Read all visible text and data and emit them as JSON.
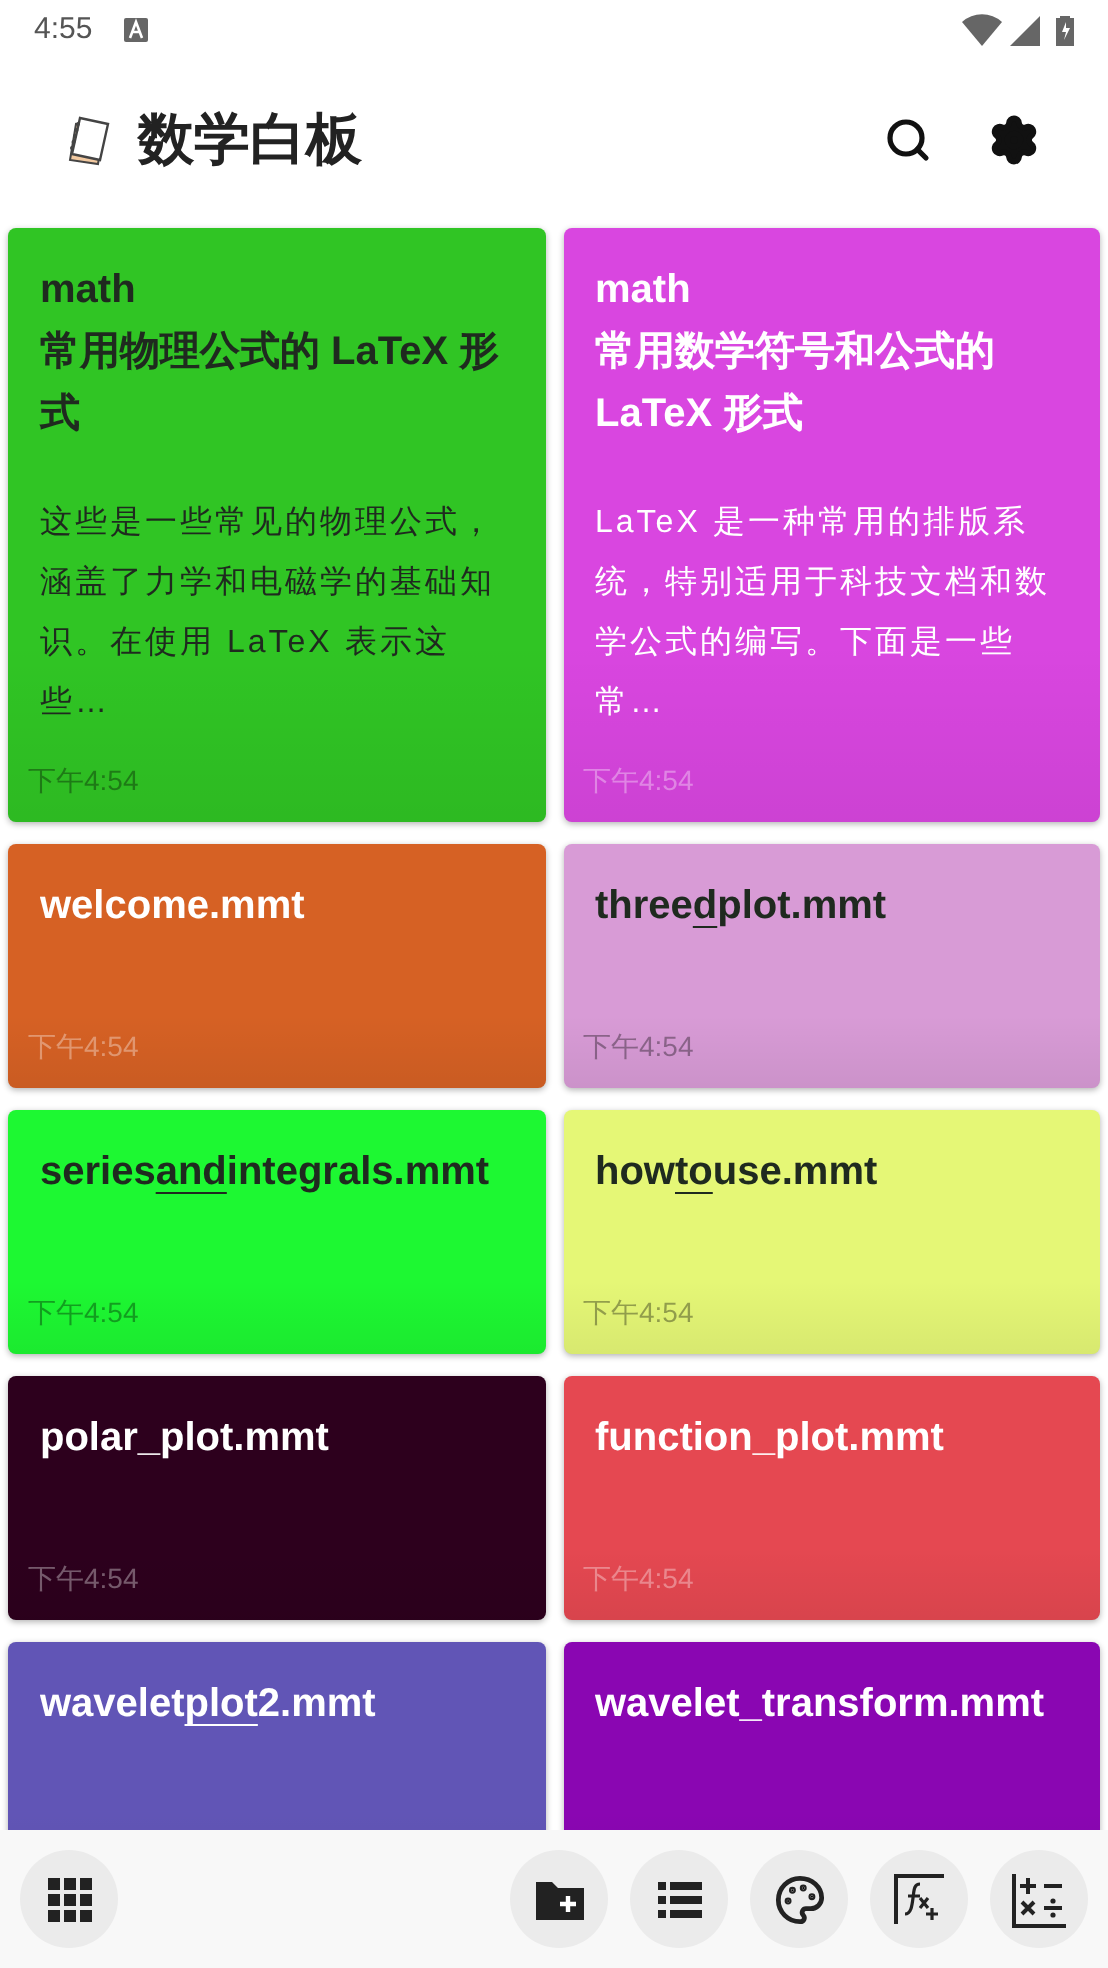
{
  "status_bar": {
    "time": "4:55"
  },
  "app_bar": {
    "title": "数学白板"
  },
  "columns": [
    {
      "cards": [
        {
          "color": "#30c524",
          "kind": "dark",
          "title": [
            {
              "text": "math\n常用物理公式的 LaTeX 形式",
              "underlined": false
            }
          ],
          "description": "这些是一些常见的物理公式，涵盖了力学和电磁学的基础知识。在使用 LaTeX 表示这些…",
          "time": "下午4:54"
        },
        {
          "color": "#d66124",
          "kind": "light",
          "title": [
            {
              "text": "welcome.mmt",
              "underlined": false
            }
          ],
          "time": "下午4:54"
        },
        {
          "color": "#1df832",
          "kind": "dark",
          "title": [
            {
              "text": "series",
              "underlined": false
            },
            {
              "text": "and",
              "underlined": true
            },
            {
              "text": "integrals.mmt",
              "underlined": false
            }
          ],
          "time": "下午4:54"
        },
        {
          "color": "#2d001d",
          "kind": "light",
          "title": [
            {
              "text": "polar_plot.mmt",
              "underlined": false
            }
          ],
          "time": "下午4:54"
        },
        {
          "color": "#6155b6",
          "kind": "light",
          "title": [
            {
              "text": "wavelet",
              "underlined": false
            },
            {
              "text": "plot",
              "underlined": true
            },
            {
              "text": "2.mmt",
              "underlined": false
            }
          ]
        }
      ]
    },
    {
      "cards": [
        {
          "color": "#d946e0",
          "kind": "light",
          "title": [
            {
              "text": "math\n常用数学符号和公式的 LaTeX 形式",
              "underlined": false
            }
          ],
          "description": "LaTeX 是一种常用的排版系统，特别适用于科技文档和数学公式的编写。下面是一些常…",
          "time": "下午4:54"
        },
        {
          "color": "#d89bd6",
          "kind": "dark",
          "title": [
            {
              "text": "three",
              "underlined": false
            },
            {
              "text": "d",
              "underlined": true
            },
            {
              "text": "plot.mmt",
              "underlined": false
            }
          ],
          "time": "下午4:54"
        },
        {
          "color": "#e5f776",
          "kind": "dark",
          "title": [
            {
              "text": "how",
              "underlined": false
            },
            {
              "text": "to",
              "underlined": true
            },
            {
              "text": "use.mmt",
              "underlined": false
            }
          ],
          "time": "下午4:54"
        },
        {
          "color": "#e54851",
          "kind": "light",
          "title": [
            {
              "text": "function_plot.mmt",
              "underlined": false
            }
          ],
          "time": "下午4:54"
        },
        {
          "color": "#8a06b2",
          "kind": "light",
          "title": [
            {
              "text": "wavelet_transform.mmt",
              "underlined": false
            }
          ]
        }
      ]
    }
  ],
  "bottom_bar": [
    {
      "kind": "grid"
    },
    {
      "kind": "spacer"
    },
    {
      "kind": "new-folder"
    },
    {
      "kind": "list"
    },
    {
      "kind": "palette"
    },
    {
      "kind": "function"
    },
    {
      "kind": "operators"
    }
  ]
}
